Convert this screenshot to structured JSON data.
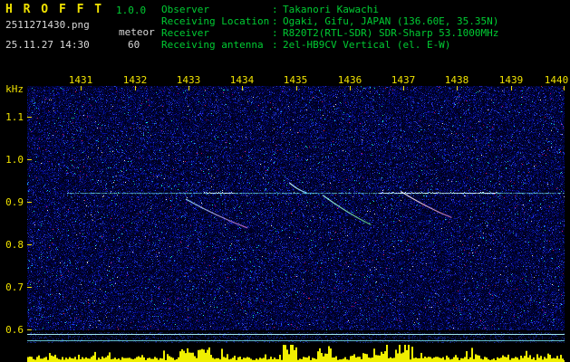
{
  "app": {
    "title": "H R O F F T",
    "version": "1.0.0",
    "filename": "2511271430.png",
    "mode": "meteor",
    "datetime": "25.11.27 14:30",
    "duration": "60"
  },
  "info": {
    "colon": ":",
    "rows": [
      {
        "label": "Observer",
        "value": "Takanori Kawachi"
      },
      {
        "label": "Receiving Location",
        "value": "Ogaki, Gifu, JAPAN (136.60E, 35.35N)"
      },
      {
        "label": "Receiver",
        "value": "R820T2(RTL-SDR) SDR-Sharp 53.1000MHz"
      },
      {
        "label": "Receiving antenna",
        "value": "2el-HB9CV Vertical (el. E-W)"
      }
    ]
  },
  "chart_data": {
    "type": "heatmap",
    "subtype": "meteor-radio-spectrogram",
    "x_range": [
      1430,
      1440
    ],
    "x_ticks": [
      "1431",
      "1432",
      "1433",
      "1434",
      "1435",
      "1436",
      "1437",
      "1438",
      "1439",
      "1440"
    ],
    "y_unit": "kHz",
    "y_range": [
      0.597,
      1.172
    ],
    "y_ticks": [
      "1.1",
      "1.0",
      "0.9",
      "0.8",
      "0.7",
      "0.6"
    ],
    "grid": false,
    "legend_position": "none",
    "carrier_khz": 0.92,
    "carrier_extent_min": [
      1430.75,
      1440
    ],
    "carrier_bright_segments": [
      [
        1433.28,
        1433.85
      ],
      [
        1436.55,
        1438.75
      ]
    ],
    "echoes": [
      {
        "t_start": 1432.95,
        "f_start": 0.906,
        "t_end": 1434.1,
        "f_end": 0.838,
        "color_start": "#9beaff",
        "color_end": "#b85fc0"
      },
      {
        "t_start": 1434.88,
        "f_start": 0.944,
        "t_end": 1435.2,
        "f_end": 0.921,
        "color_start": "#d0ffff",
        "color_end": "#7fd8ff"
      },
      {
        "t_start": 1435.5,
        "f_start": 0.915,
        "t_end": 1436.4,
        "f_end": 0.845,
        "color_start": "#a8ffe8",
        "color_end": "#58bb77"
      },
      {
        "t_start": 1436.95,
        "f_start": 0.924,
        "t_end": 1437.9,
        "f_end": 0.862,
        "color_start": "#ffffff",
        "color_end": "#c86fae"
      }
    ],
    "bottom_strip": {
      "line_count": 2
    },
    "colors": {
      "background": "#000000",
      "noise_base": "#000a2e",
      "carrier": "#7dffff",
      "ticks": "#f0e200",
      "bars": "#f0ef00",
      "strip_lines": "#8cffff",
      "header_green": "#00cc33",
      "header_yellow": "#f0e200",
      "header_silver": "#d9d9d9"
    }
  }
}
